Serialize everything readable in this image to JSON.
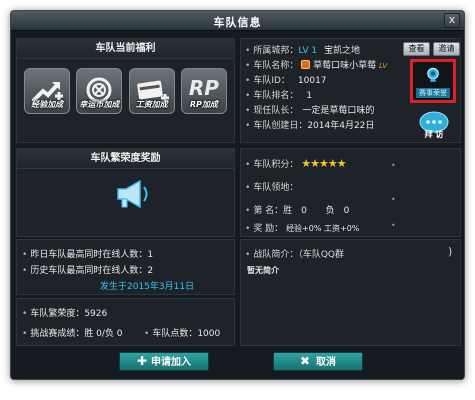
{
  "window": {
    "title": "车队信息",
    "close_label": "x"
  },
  "benefits": {
    "title": "车队当前福利",
    "items": [
      {
        "label": "经验加成",
        "icon": "exp-up-icon"
      },
      {
        "label": "幸运币加成",
        "icon": "lucky-coin-icon"
      },
      {
        "label": "工资加成",
        "icon": "salary-card-icon"
      },
      {
        "label": "RP加成",
        "icon": "rp-icon",
        "glyph": "RP"
      }
    ]
  },
  "prosperity_reward": {
    "title": "车队繁荣度奖励",
    "icon": "megaphone-icon"
  },
  "online": {
    "yesterday_max": "昨日车队最高同时在线人数：1",
    "history_max": "历史车队最高同时在线人数：2",
    "history_date": "发生于2015年3月11日"
  },
  "stats": {
    "prosperity": "车队繁荣度：5926",
    "challenge": "挑战赛成绩：胜 0/负 0",
    "points": "车队点数：1000"
  },
  "info": {
    "server_label": "所属城邦：",
    "server_lv": "LV 1",
    "server_name": "宝凯之地",
    "name_label": "车队名称：",
    "name_value": "草莓口味小草莓",
    "id_label": "车队ID：",
    "id_value": "10017",
    "rank_label": "车队排名：",
    "rank_value": "1",
    "leader_label": "现任队长：",
    "leader_value": "一定是草莓口味的",
    "created_label": "车队创建日：",
    "created_value": "2014年4月22日",
    "view_button": "查看",
    "invite_button": "邀请",
    "trophy_caption": "赛事荣誉",
    "visit_button": "拜 访"
  },
  "score": {
    "points_label": "车队积分：",
    "stars": 5,
    "territory_label": "车队领地：",
    "record_label": "第 名：胜",
    "wins": "0",
    "losses_label": "负",
    "losses": "0",
    "reward_label": "奖 励：",
    "reward_value": "经验+0%  工资+0%"
  },
  "intro": {
    "label": "战队简介：（车队QQ群",
    "value": "暂无简介"
  },
  "actions": {
    "apply": "申请加入",
    "cancel": "取消"
  },
  "colors": {
    "accent": "#3cc0f0",
    "button": "#1f8886",
    "highlight": "#e01e28",
    "star": "#f3c824"
  }
}
